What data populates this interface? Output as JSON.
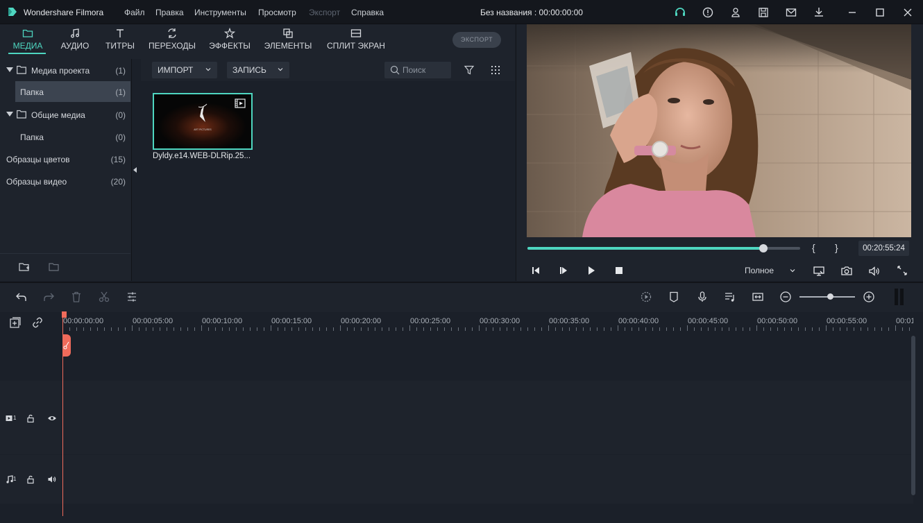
{
  "app": {
    "title": "Wondershare Filmora",
    "document_title": "Без названия : 00:00:00:00",
    "accent_color": "#4ed6c0",
    "playhead_color": "#f06b5b"
  },
  "menu": [
    "Файл",
    "Правка",
    "Инструменты",
    "Просмотр",
    "Экспорт",
    "Справка"
  ],
  "titlebar_icons": [
    "headset-icon",
    "alert-icon",
    "user-icon",
    "save-icon",
    "mail-icon",
    "download-icon",
    "minimize-icon",
    "maximize-icon",
    "close-icon"
  ],
  "tabs": [
    {
      "label": "МЕДИА",
      "icon": "folder-icon",
      "active": true
    },
    {
      "label": "АУДИО",
      "icon": "music-note-icon"
    },
    {
      "label": "ТИТРЫ",
      "icon": "text-icon"
    },
    {
      "label": "ПЕРЕХОДЫ",
      "icon": "transition-icon"
    },
    {
      "label": "ЭФФЕКТЫ",
      "icon": "effects-icon"
    },
    {
      "label": "ЭЛЕМЕНТЫ",
      "icon": "elements-icon"
    },
    {
      "label": "СПЛИТ ЭКРАН",
      "icon": "split-screen-icon"
    }
  ],
  "export_button": "ЭКСПОРТ",
  "folders": [
    {
      "label": "Медиа проекта",
      "count": "(1)"
    },
    {
      "label": "Папка",
      "count": "(1)"
    },
    {
      "label": "Общие медиа",
      "count": "(0)"
    },
    {
      "label": "Папка",
      "count": "(0)"
    },
    {
      "label": "Образцы цветов",
      "count": "(15)"
    },
    {
      "label": "Образцы видео",
      "count": "(20)"
    }
  ],
  "media_toolbar": {
    "import_label": "ИМПОРТ",
    "record_label": "ЗАПИСЬ",
    "search_placeholder": "Поиск"
  },
  "media_items": [
    {
      "name": "Dyldy.e14.WEB-DLRip.25...",
      "thumb_text": "ART PICTURES"
    }
  ],
  "preview": {
    "progress": 0.865,
    "timecode": "00:20:55:24",
    "quality": "Полное",
    "mark_in": "{",
    "mark_out": "}"
  },
  "timeline": {
    "ruler_labels": [
      "00:00:00:00",
      "00:00:05:00",
      "00:00:10:00",
      "00:00:15:00",
      "00:00:20:00",
      "00:00:25:00",
      "00:00:30:00",
      "00:00:35:00",
      "00:00:40:00",
      "00:00:45:00",
      "00:00:50:00",
      "00:00:55:00",
      "00:01:"
    ],
    "video_track": "1",
    "audio_track": "1",
    "zoom_level": 0.55
  }
}
